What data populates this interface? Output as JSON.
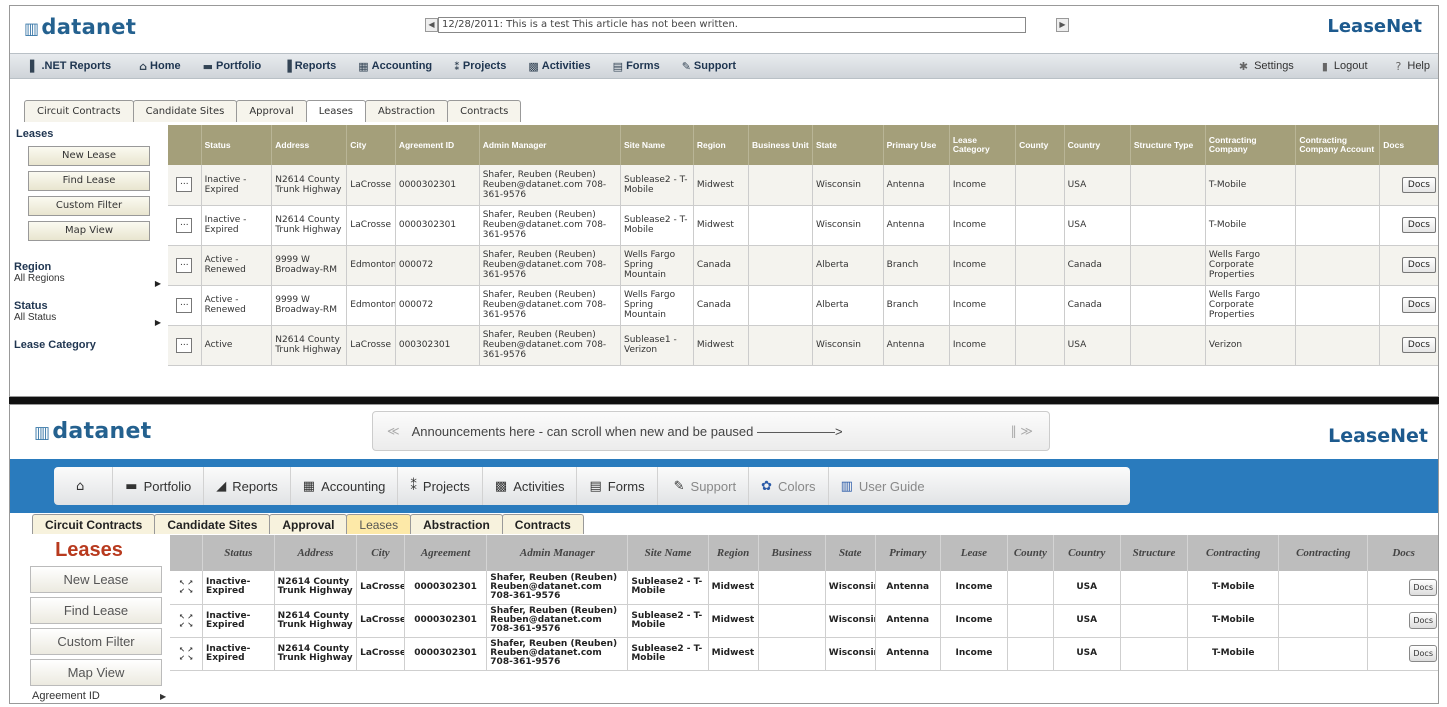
{
  "top": {
    "logo": "datanet",
    "brand": "LeaseNet",
    "ticker_text": "12/28/2011: This is a test   This article has not been written.",
    "nav": [
      {
        "icon": "bar-chart-icon",
        "glyph": "▌",
        "label": ".NET Reports"
      },
      {
        "icon": "home-icon",
        "glyph": "⌂",
        "label": "Home"
      },
      {
        "icon": "folder-icon",
        "glyph": "▬",
        "label": "Portfolio"
      },
      {
        "icon": "chart-icon",
        "glyph": "▐",
        "label": "Reports"
      },
      {
        "icon": "calculator-icon",
        "glyph": "▦",
        "label": "Accounting"
      },
      {
        "icon": "projects-icon",
        "glyph": "⁑",
        "label": "Projects"
      },
      {
        "icon": "activities-icon",
        "glyph": "▩",
        "label": "Activities"
      },
      {
        "icon": "forms-icon",
        "glyph": "▤",
        "label": "Forms"
      },
      {
        "icon": "wrench-icon",
        "glyph": "✎",
        "label": "Support"
      }
    ],
    "nav_right": [
      {
        "icon": "gear-icon",
        "glyph": "✱",
        "label": "Settings"
      },
      {
        "icon": "logout-icon",
        "glyph": "▮",
        "label": "Logout"
      },
      {
        "icon": "help-icon",
        "glyph": "?",
        "label": "Help"
      }
    ],
    "tabs": [
      "Circuit Contracts",
      "Candidate Sites",
      "Approval",
      "Leases",
      "Abstraction",
      "Contracts"
    ],
    "active_tab": "Leases",
    "sidebar": {
      "title": "Leases",
      "buttons": [
        "New Lease",
        "Find Lease",
        "Custom Filter",
        "Map View"
      ],
      "sections": [
        {
          "label": "Region",
          "value": "All Regions"
        },
        {
          "label": "Status",
          "value": "All Status"
        },
        {
          "label": "Lease Category",
          "value": ""
        }
      ]
    },
    "columns": [
      "",
      "Status",
      "Address",
      "City",
      "Agreement ID",
      "Admin Manager",
      "Site Name",
      "Region",
      "Business Unit",
      "State",
      "Primary Use",
      "Lease Category",
      "County",
      "Country",
      "Structure Type",
      "Contracting Company",
      "Contracting Company Account",
      "Docs"
    ],
    "rows": [
      {
        "btn": "...",
        "status": "Inactive - Expired",
        "address": "N2614 County Trunk Highway",
        "city": "LaCrosse",
        "agreement": "0000302301",
        "admin": "Shafer, Reuben (Reuben) Reuben@datanet.com 708-361-9576",
        "site": "Sublease2 - T-Mobile",
        "region": "Midwest",
        "business": "",
        "state": "Wisconsin",
        "use": "Antenna",
        "category": "Income",
        "county": "",
        "country": "USA",
        "structure": "",
        "company": "T-Mobile",
        "account": "",
        "docs": "Docs"
      },
      {
        "btn": "...",
        "status": "Inactive - Expired",
        "address": "N2614 County Trunk Highway",
        "city": "LaCrosse",
        "agreement": "0000302301",
        "admin": "Shafer, Reuben (Reuben) Reuben@datanet.com 708-361-9576",
        "site": "Sublease2 - T-Mobile",
        "region": "Midwest",
        "business": "",
        "state": "Wisconsin",
        "use": "Antenna",
        "category": "Income",
        "county": "",
        "country": "USA",
        "structure": "",
        "company": "T-Mobile",
        "account": "",
        "docs": "Docs"
      },
      {
        "btn": "...",
        "status": "Active - Renewed",
        "address": "9999 W Broadway-RM",
        "city": "Edmonton",
        "agreement": "000072",
        "admin": "Shafer, Reuben (Reuben) Reuben@datanet.com 708-361-9576",
        "site": "Wells Fargo Spring Mountain",
        "region": "Canada",
        "business": "",
        "state": "Alberta",
        "use": "Branch",
        "category": "Income",
        "county": "",
        "country": "Canada",
        "structure": "",
        "company": "Wells Fargo Corporate Properties",
        "account": "",
        "docs": "Docs"
      },
      {
        "btn": "...",
        "status": "Active - Renewed",
        "address": "9999 W Broadway-RM",
        "city": "Edmonton",
        "agreement": "000072",
        "admin": "Shafer, Reuben (Reuben) Reuben@datanet.com 708-361-9576",
        "site": "Wells Fargo Spring Mountain",
        "region": "Canada",
        "business": "",
        "state": "Alberta",
        "use": "Branch",
        "category": "Income",
        "county": "",
        "country": "Canada",
        "structure": "",
        "company": "Wells Fargo Corporate Properties",
        "account": "",
        "docs": "Docs"
      },
      {
        "btn": "...",
        "status": "Active",
        "address": "N2614 County Trunk Highway",
        "city": "LaCrosse",
        "agreement": "000302301",
        "admin": "Shafer, Reuben (Reuben) Reuben@datanet.com 708-361-9576",
        "site": "Sublease1 - Verizon",
        "region": "Midwest",
        "business": "",
        "state": "Wisconsin",
        "use": "Antenna",
        "category": "Income",
        "county": "",
        "country": "USA",
        "structure": "",
        "company": "Verizon",
        "account": "",
        "docs": "Docs"
      }
    ]
  },
  "bottom": {
    "logo": "datanet",
    "brand": "LeaseNet",
    "announcement": "Announcements here - can scroll when new and be paused ——————>",
    "nav": [
      {
        "icon": "home-icon",
        "glyph": "⌂",
        "label": ""
      },
      {
        "icon": "folder-icon",
        "glyph": "▬",
        "label": "Portfolio"
      },
      {
        "icon": "reports-icon",
        "glyph": "◢",
        "label": "Reports"
      },
      {
        "icon": "calculator-icon",
        "glyph": "▦",
        "label": "Accounting"
      },
      {
        "icon": "projects-icon",
        "glyph": "⁑",
        "label": "Projects"
      },
      {
        "icon": "activities-icon",
        "glyph": "▩",
        "label": "Activities"
      },
      {
        "icon": "forms-icon",
        "glyph": "▤",
        "label": "Forms"
      },
      {
        "icon": "wrench-icon",
        "glyph": "✎",
        "label": "Support"
      },
      {
        "icon": "palette-icon",
        "glyph": "✿",
        "label": "Colors"
      },
      {
        "icon": "user-guide-icon",
        "glyph": "▥",
        "label": "User Guide"
      }
    ],
    "tabs": [
      "Circuit Contracts",
      "Candidate Sites",
      "Approval",
      "Leases",
      "Abstraction",
      "Contracts"
    ],
    "active_tab": "Leases",
    "sidebar": {
      "title": "Leases",
      "buttons": [
        "New Lease",
        "Find Lease",
        "Custom Filter",
        "Map View"
      ],
      "section": "Agreement ID"
    },
    "columns": [
      "",
      "Status",
      "Address",
      "City",
      "Agreement",
      "Admin Manager",
      "Site Name",
      "Region",
      "Business",
      "State",
      "Primary",
      "Lease",
      "County",
      "Country",
      "Structure",
      "Contracting",
      "Contracting",
      "Docs"
    ],
    "rows": [
      {
        "status": "Inactive- Expired",
        "address": "N2614 County Trunk Highway",
        "city": "LaCrosse",
        "agreement": "0000302301",
        "admin": "Shafer, Reuben (Reuben) Reuben@datanet.com 708-361-9576",
        "site": "Sublease2 - T-Mobile",
        "region": "Midwest",
        "business": "",
        "state": "Wisconsin",
        "use": "Antenna",
        "category": "Income",
        "county": "",
        "country": "USA",
        "structure": "",
        "company": "T-Mobile",
        "account": "",
        "docs": "Docs"
      },
      {
        "status": "Inactive- Expired",
        "address": "N2614 County Trunk Highway",
        "city": "LaCrosse",
        "agreement": "0000302301",
        "admin": "Shafer, Reuben (Reuben) Reuben@datanet.com 708-361-9576",
        "site": "Sublease2 - T-Mobile",
        "region": "Midwest",
        "business": "",
        "state": "Wisconsin",
        "use": "Antenna",
        "category": "Income",
        "county": "",
        "country": "USA",
        "structure": "",
        "company": "T-Mobile",
        "account": "",
        "docs": "Docs"
      },
      {
        "status": "Inactive- Expired",
        "address": "N2614 County Trunk Highway",
        "city": "LaCrosse",
        "agreement": "0000302301",
        "admin": "Shafer, Reuben (Reuben) Reuben@datanet.com 708-361-9576",
        "site": "Sublease2 - T-Mobile",
        "region": "Midwest",
        "business": "",
        "state": "Wisconsin",
        "use": "Antenna",
        "category": "Income",
        "county": "",
        "country": "USA",
        "structure": "",
        "company": "T-Mobile",
        "account": "",
        "docs": "Docs"
      }
    ]
  },
  "colors": {
    "brand_blue": "#1d5a8e",
    "navbar_blue": "#2a7bbd",
    "top_header": "#a49f7a",
    "bottom_header": "#bdbdbd",
    "sidebar_title_red": "#b83a1e",
    "active_tab_yellow": "#fde9a8"
  }
}
